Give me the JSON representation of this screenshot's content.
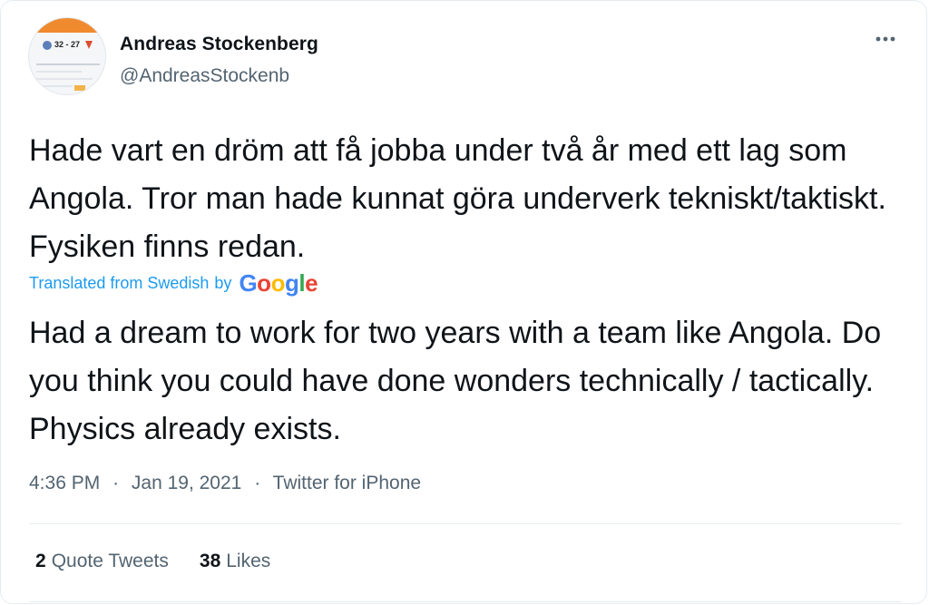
{
  "tweet": {
    "author": {
      "name": "Andreas Stockenberg",
      "handle": "@AndreasStockenb",
      "avatar_score": "32 - 27"
    },
    "original_text": "Hade vart en dröm att få jobba under två år med ett lag som Angola. Tror man hade kunnat göra underverk tekniskt/taktiskt. Fysiken finns redan.",
    "translation": {
      "label": "Translated from Swedish",
      "by": "by",
      "provider": "Google",
      "text": "Had a dream to work for two years with a team like Angola. Do you think you could have done wonders technically / tactically. Physics already exists."
    },
    "time": "4:36 PM",
    "separator": "·",
    "date": "Jan 19, 2021",
    "source": "Twitter for iPhone",
    "stats": {
      "quote_count": "2",
      "quote_label": "Quote Tweets",
      "likes_count": "38",
      "likes_label": "Likes"
    }
  },
  "icons": {
    "more": "more-horizontal-icon"
  },
  "colors": {
    "link_blue": "#1d9bf0",
    "secondary_text": "#536471",
    "google_blue": "#4285F4",
    "google_red": "#EA4335",
    "google_yellow": "#FBBC05",
    "google_green": "#34A853"
  }
}
